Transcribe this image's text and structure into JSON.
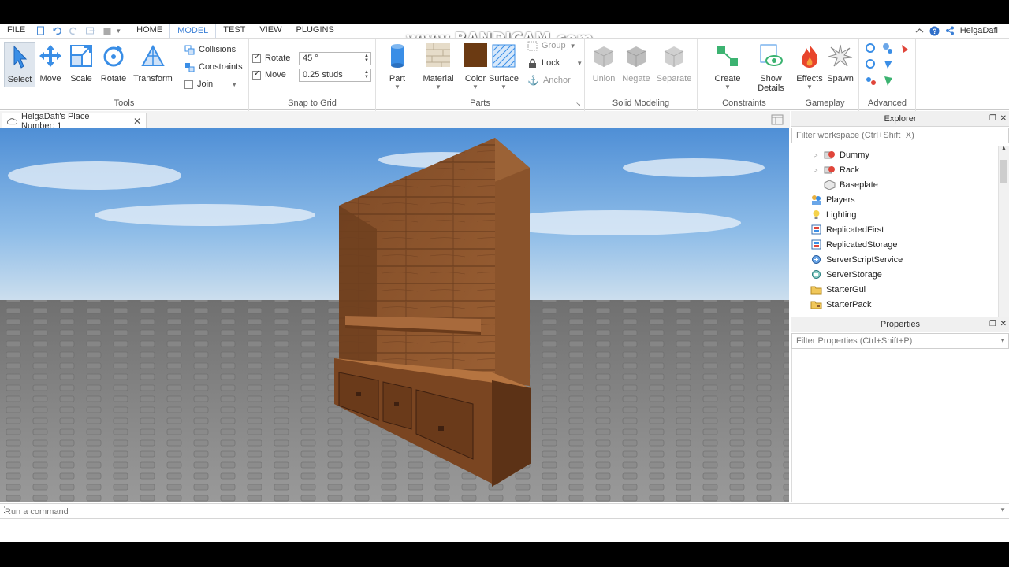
{
  "watermark": "www.BANDICAM.com",
  "menu": {
    "file": "FILE",
    "tabs": [
      "HOME",
      "MODEL",
      "TEST",
      "VIEW",
      "PLUGINS"
    ],
    "active_tab": "MODEL"
  },
  "user": {
    "name": "HelgaDafi"
  },
  "tools": {
    "label": "Tools",
    "select": "Select",
    "move": "Move",
    "scale": "Scale",
    "rotate": "Rotate",
    "transform": "Transform",
    "collisions": "Collisions",
    "constraints": "Constraints",
    "join": "Join"
  },
  "snap": {
    "label": "Snap to Grid",
    "rotate_label": "Rotate",
    "rotate_value": "45 °",
    "rotate_checked": true,
    "move_label": "Move",
    "move_value": "0.25 studs",
    "move_checked": true
  },
  "parts": {
    "label": "Parts",
    "part": "Part",
    "material": "Material",
    "color": "Color",
    "surface": "Surface",
    "group": "Group",
    "lock": "Lock",
    "anchor": "Anchor",
    "color_swatch": "#6b3a12"
  },
  "solid": {
    "label": "Solid Modeling",
    "union": "Union",
    "negate": "Negate",
    "separate": "Separate"
  },
  "constraints": {
    "label": "Constraints",
    "create": "Create",
    "show_details": [
      "Show",
      "Details"
    ]
  },
  "gameplay": {
    "label": "Gameplay",
    "effects": "Effects",
    "spawn": "Spawn"
  },
  "advanced": {
    "label": "Advanced"
  },
  "document": {
    "tab_title": "HelgaDafi's Place Number: 1"
  },
  "explorer": {
    "title": "Explorer",
    "filter_placeholder": "Filter workspace (Ctrl+Shift+X)",
    "items": [
      {
        "label": "Dummy",
        "icon": "model-icon",
        "expandable": true
      },
      {
        "label": "Rack",
        "icon": "model-icon",
        "expandable": true
      },
      {
        "label": "Baseplate",
        "icon": "part-icon",
        "expandable": false
      },
      {
        "label": "Players",
        "icon": "players-icon",
        "expandable": false
      },
      {
        "label": "Lighting",
        "icon": "lighting-icon",
        "expandable": false
      },
      {
        "label": "ReplicatedFirst",
        "icon": "replicated-first-icon",
        "expandable": false
      },
      {
        "label": "ReplicatedStorage",
        "icon": "replicated-storage-icon",
        "expandable": false
      },
      {
        "label": "ServerScriptService",
        "icon": "server-script-service-icon",
        "expandable": false
      },
      {
        "label": "ServerStorage",
        "icon": "server-storage-icon",
        "expandable": false
      },
      {
        "label": "StarterGui",
        "icon": "starter-gui-icon",
        "expandable": false
      },
      {
        "label": "StarterPack",
        "icon": "starter-pack-icon",
        "expandable": false
      }
    ]
  },
  "properties": {
    "title": "Properties",
    "filter_placeholder": "Filter Properties (Ctrl+Shift+P)"
  },
  "command_bar": {
    "placeholder": "Run a command"
  }
}
